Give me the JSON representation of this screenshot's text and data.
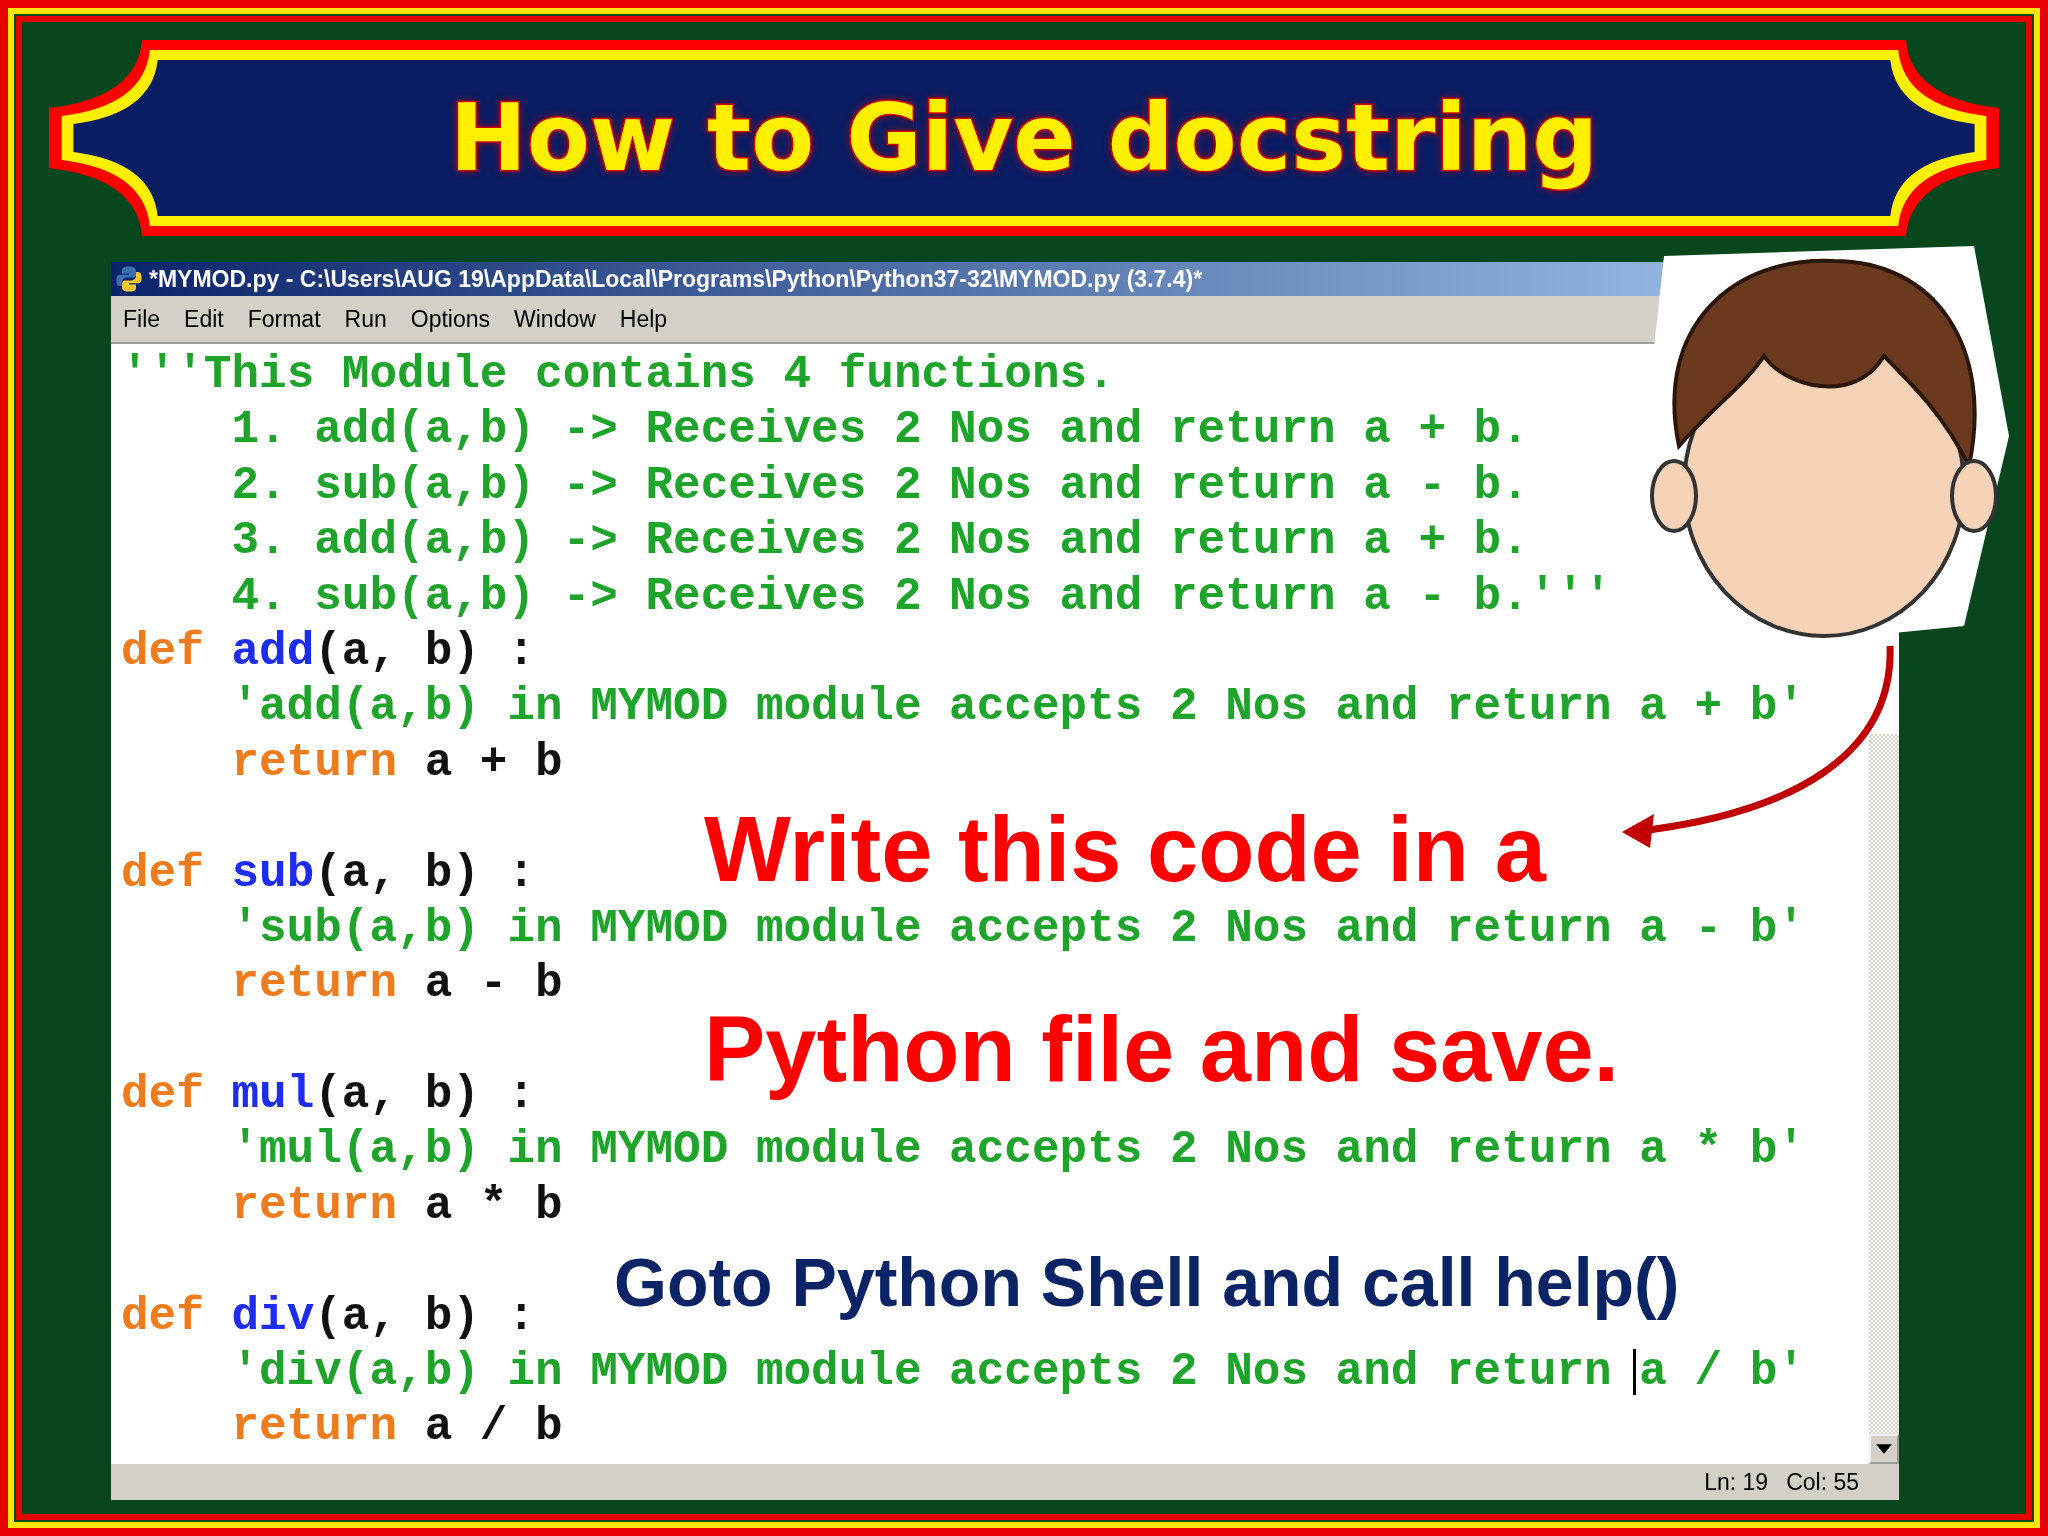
{
  "slide_title": "How to Give docstring",
  "window": {
    "title": "*MYMOD.py - C:\\Users\\AUG 19\\AppData\\Local\\Programs\\Python\\Python37-32\\MYMOD.py (3.7.4)*"
  },
  "menu": [
    "File",
    "Edit",
    "Format",
    "Run",
    "Options",
    "Window",
    "Help"
  ],
  "code_lines": [
    {
      "blank_before": false,
      "indented": false,
      "segments": [
        {
          "kind": "str",
          "text": "'''This Module contains 4 functions."
        }
      ]
    },
    {
      "blank_before": false,
      "indented": true,
      "segments": [
        {
          "kind": "str",
          "text": "1. add(a,b) -> Receives 2 Nos and return a + b."
        }
      ]
    },
    {
      "blank_before": false,
      "indented": true,
      "segments": [
        {
          "kind": "str",
          "text": "2. sub(a,b) -> Receives 2 Nos and return a - b."
        }
      ]
    },
    {
      "blank_before": false,
      "indented": true,
      "segments": [
        {
          "kind": "str",
          "text": "3. add(a,b) -> Receives 2 Nos and return a + b."
        }
      ]
    },
    {
      "blank_before": false,
      "indented": true,
      "segments": [
        {
          "kind": "str",
          "text": "4. sub(a,b) -> Receives 2 Nos and return a - b.'''"
        }
      ]
    },
    {
      "blank_before": false,
      "indented": false,
      "segments": [
        {
          "kind": "kw",
          "text": "def"
        },
        {
          "kind": "name",
          "text": "add"
        },
        {
          "kind": "plain",
          "text": "(a, b) :"
        }
      ]
    },
    {
      "blank_before": false,
      "indented": true,
      "segments": [
        {
          "kind": "str",
          "text": "'add(a,b) in MYMOD module accepts 2 Nos and return a + b'"
        }
      ]
    },
    {
      "blank_before": false,
      "indented": true,
      "segments": [
        {
          "kind": "kw",
          "text": "return"
        },
        {
          "kind": "plain",
          "text": " a + b"
        }
      ]
    },
    {
      "blank_before": true,
      "indented": false,
      "segments": [
        {
          "kind": "kw",
          "text": "def"
        },
        {
          "kind": "name",
          "text": "sub"
        },
        {
          "kind": "plain",
          "text": "(a, b) :"
        }
      ]
    },
    {
      "blank_before": false,
      "indented": true,
      "segments": [
        {
          "kind": "str",
          "text": "'sub(a,b) in MYMOD module accepts 2 Nos and return a - b'"
        }
      ]
    },
    {
      "blank_before": false,
      "indented": true,
      "segments": [
        {
          "kind": "kw",
          "text": "return"
        },
        {
          "kind": "plain",
          "text": " a - b"
        }
      ]
    },
    {
      "blank_before": true,
      "indented": false,
      "segments": [
        {
          "kind": "kw",
          "text": "def"
        },
        {
          "kind": "name",
          "text": "mul"
        },
        {
          "kind": "plain",
          "text": "(a, b) :"
        }
      ]
    },
    {
      "blank_before": false,
      "indented": true,
      "segments": [
        {
          "kind": "str",
          "text": "'mul(a,b) in MYMOD module accepts 2 Nos and return a * b'"
        }
      ]
    },
    {
      "blank_before": false,
      "indented": true,
      "segments": [
        {
          "kind": "kw",
          "text": "return"
        },
        {
          "kind": "plain",
          "text": " a * b"
        }
      ]
    },
    {
      "blank_before": true,
      "indented": false,
      "segments": [
        {
          "kind": "kw",
          "text": "def"
        },
        {
          "kind": "name",
          "text": "div"
        },
        {
          "kind": "plain",
          "text": "(a, b) :"
        }
      ]
    },
    {
      "blank_before": false,
      "indented": true,
      "segments": [
        {
          "kind": "str",
          "text": "'div(a,b) in MYMOD module accepts 2 Nos and return "
        },
        {
          "kind": "str",
          "text": "a / b'",
          "cursor": true
        }
      ]
    },
    {
      "blank_before": false,
      "indented": true,
      "segments": [
        {
          "kind": "kw",
          "text": "return"
        },
        {
          "kind": "plain",
          "text": " a / b"
        }
      ]
    }
  ],
  "status_bar": {
    "line": "Ln: 19",
    "column": "Col: 55"
  },
  "callouts": [
    {
      "kind": "red",
      "text": "Write this code in a"
    },
    {
      "kind": "red",
      "text": "Python file and save."
    },
    {
      "kind": "blue",
      "text": "Goto Python Shell and call help()"
    }
  ]
}
